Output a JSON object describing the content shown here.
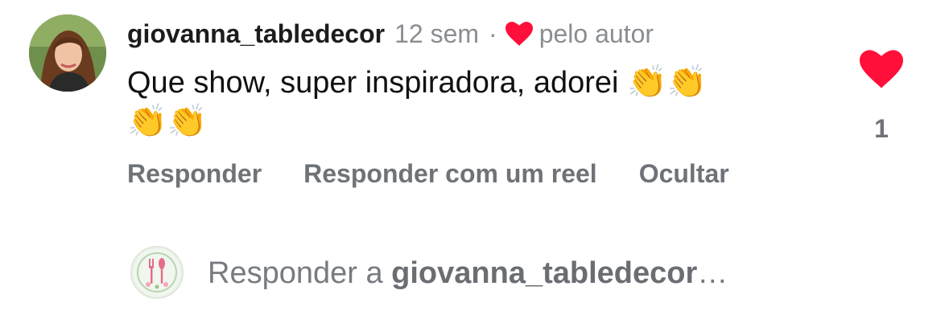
{
  "comment": {
    "username": "giovanna_tabledecor",
    "timestamp": "12 sem",
    "separator": "·",
    "author_like_label": "pelo autor",
    "text": "Que show, super inspiradora, adorei",
    "emojis": [
      "👏",
      "👏",
      "👏",
      "👏"
    ],
    "avatar_icon": "profile-photo",
    "like_count": "1",
    "liked": true
  },
  "actions": {
    "reply_label": "Responder",
    "reply_reel_label": "Responder com um reel",
    "hide_label": "Ocultar"
  },
  "reply_box": {
    "prefix": "Responder a",
    "mention": "giovanna_tabledecor",
    "ellipsis": "…",
    "avatar_icon": "cutlery-logo"
  },
  "colors": {
    "heart": "#ff0f3a",
    "secondary_text": "#8a8d91",
    "action_text": "#6f7378",
    "primary_text": "#111111"
  }
}
